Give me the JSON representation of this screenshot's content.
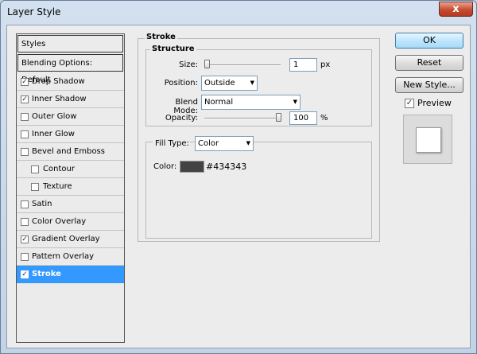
{
  "window": {
    "title": "Layer Style",
    "close_glyph": "x"
  },
  "styles_list": {
    "header": "Styles",
    "blending_options": "Blending Options: Default",
    "items": [
      {
        "label": "Drop Shadow",
        "checked": true
      },
      {
        "label": "Inner Shadow",
        "checked": true
      },
      {
        "label": "Outer Glow",
        "checked": false
      },
      {
        "label": "Inner Glow",
        "checked": false
      },
      {
        "label": "Bevel and Emboss",
        "checked": false
      },
      {
        "label": "Contour",
        "checked": false
      },
      {
        "label": "Texture",
        "checked": false
      },
      {
        "label": "Satin",
        "checked": false
      },
      {
        "label": "Color Overlay",
        "checked": false
      },
      {
        "label": "Gradient Overlay",
        "checked": true
      },
      {
        "label": "Pattern Overlay",
        "checked": false
      },
      {
        "label": "Stroke",
        "checked": true
      }
    ]
  },
  "stroke": {
    "title": "Stroke",
    "structure": {
      "title": "Structure",
      "size_label": "Size:",
      "size_value": "1",
      "size_unit": "px",
      "size_slider_fraction": 0.0,
      "position_label": "Position:",
      "position_value": "Outside",
      "blend_mode_label": "Blend Mode:",
      "blend_mode_value": "Normal",
      "opacity_label": "Opacity:",
      "opacity_value": "100",
      "opacity_unit": "%",
      "opacity_slider_fraction": 1.0
    },
    "fill": {
      "fill_type_label": "Fill Type:",
      "fill_type_value": "Color",
      "color_label": "Color:",
      "color_hex": "#434343",
      "swatch_color": "#434343"
    }
  },
  "buttons": {
    "ok": "OK",
    "reset": "Reset",
    "new_style": "New Style...",
    "preview_label": "Preview",
    "preview_checked": true
  },
  "icons": {
    "check": "✓",
    "dropdown": "▼"
  }
}
